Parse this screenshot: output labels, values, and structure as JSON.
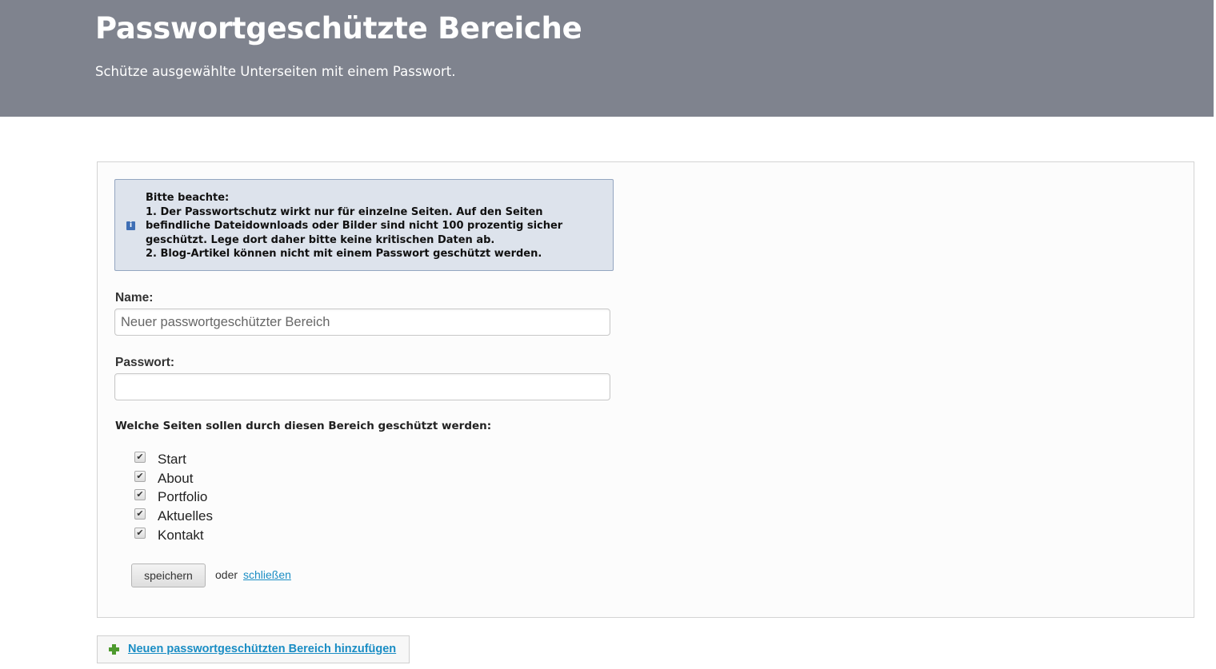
{
  "header": {
    "title": "Passwortgeschützte Bereiche",
    "subtitle": "Schütze ausgewählte Unterseiten mit einem Passwort."
  },
  "notice": {
    "icon": "info-icon",
    "lines": [
      "Bitte beachte:",
      "1. Der Passwortschutz wirkt nur für einzelne Seiten. Auf den Seiten",
      "befindliche Dateidownloads oder Bilder sind nicht 100 prozentig sicher",
      "geschützt. Lege dort daher bitte keine kritischen Daten ab.",
      "2. Blog-Artikel können nicht mit einem Passwort geschützt werden."
    ]
  },
  "form": {
    "name_label": "Name:",
    "name_placeholder": "Neuer passwortgeschützter Bereich",
    "name_value": "",
    "password_label": "Passwort:",
    "password_value": "",
    "pages_question": "Welche Seiten sollen durch diesen Bereich geschützt werden:",
    "pages": [
      {
        "label": "Start",
        "checked": true
      },
      {
        "label": "About",
        "checked": true
      },
      {
        "label": "Portfolio",
        "checked": true
      },
      {
        "label": "Aktuelles",
        "checked": true
      },
      {
        "label": "Kontakt",
        "checked": true
      }
    ],
    "save_label": "speichern",
    "or_text": "oder",
    "close_label": "schließen"
  },
  "add_area": {
    "icon": "plus-icon",
    "label": "Neuen passwortgeschützten Bereich hinzufügen"
  },
  "colors": {
    "header_bg": "#7f838e",
    "notice_bg": "#dde3ec",
    "link": "#1a8dc4",
    "plus": "#4e9a2e"
  }
}
